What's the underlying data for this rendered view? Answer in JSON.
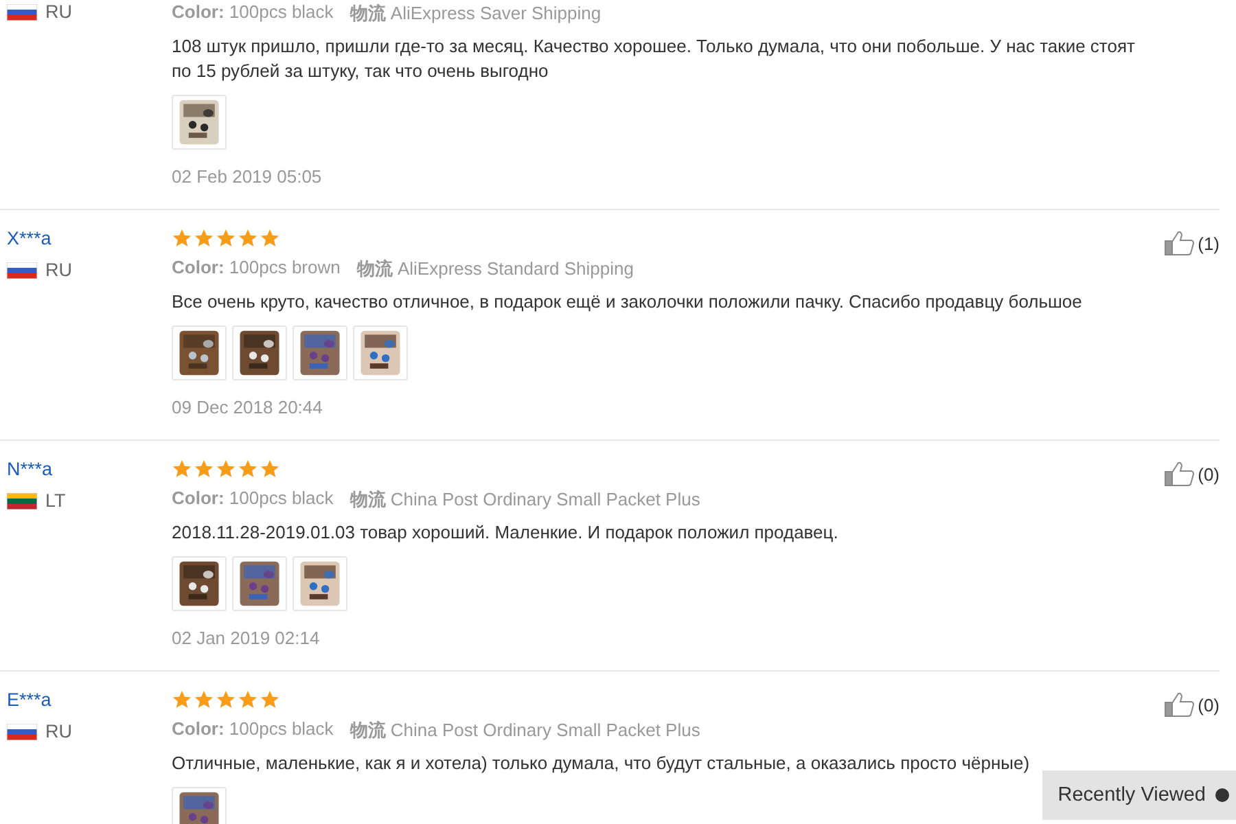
{
  "reviews": [
    {
      "country": {
        "code": "RU",
        "kind": "ru"
      },
      "color_label": "Color:",
      "variant": "100pcs black",
      "shipping_label": "物流",
      "shipping": "AliExpress Saver Shipping",
      "text": "108 штук пришло, пришли где-то за месяц. Качество хорошее. Только думала, что они побольше. У нас такие стоят по 15 рублей за штуку, так что очень выгодно",
      "photos": [
        {
          "kind": "picture"
        }
      ],
      "date": "02 Feb 2019 05:05"
    },
    {
      "name": "X***a",
      "country": {
        "code": "RU",
        "kind": "ru"
      },
      "stars": 5,
      "color_label": "Color:",
      "variant": "100pcs brown",
      "shipping_label": "物流",
      "shipping": "AliExpress Standard Shipping",
      "text": "Все очень круто, качество отличное, в подарок ещё и заколочки положили пачку. Спасибо продавцу большое",
      "photos": [
        {
          "kind": "picture"
        },
        {
          "kind": "picture"
        },
        {
          "kind": "picture"
        },
        {
          "kind": "picture"
        }
      ],
      "date": "09 Dec 2018 20:44",
      "likes": "(1)"
    },
    {
      "name": "N***a",
      "country": {
        "code": "LT",
        "kind": "lt"
      },
      "stars": 5,
      "color_label": "Color:",
      "variant": "100pcs black",
      "shipping_label": "物流",
      "shipping": "China Post Ordinary Small Packet Plus",
      "text": "2018.11.28-2019.01.03 товар хороший. Маленкие. И подарок положил продавец.",
      "photos": [
        {
          "kind": "picture"
        },
        {
          "kind": "picture"
        },
        {
          "kind": "picture"
        }
      ],
      "date": "02 Jan 2019 02:14",
      "likes": "(0)"
    },
    {
      "name": "E***a",
      "country": {
        "code": "RU",
        "kind": "ru"
      },
      "stars": 5,
      "color_label": "Color:",
      "variant": "100pcs black",
      "shipping_label": "物流",
      "shipping": "China Post Ordinary Small Packet Plus",
      "text": "Отличные, маленькие, как я и хотела) только думала, что будут стальные, а оказались просто чёрные)",
      "photos": [
        {
          "kind": "picture"
        }
      ],
      "likes": "(0)"
    }
  ],
  "recently_viewed": {
    "label": "Recently Viewed"
  }
}
